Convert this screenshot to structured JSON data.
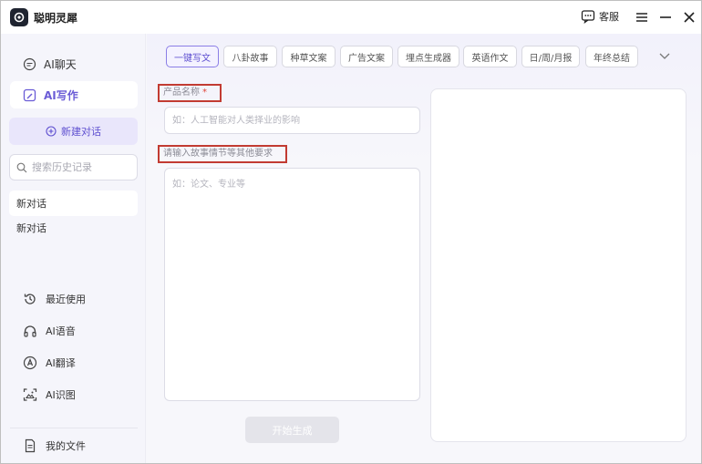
{
  "app": {
    "title": "聪明灵犀",
    "service_label": "客服"
  },
  "sidebar": {
    "nav": [
      {
        "label": "AI聊天",
        "icon": "chat-icon"
      },
      {
        "label": "AI写作",
        "icon": "write-icon",
        "active": true
      }
    ],
    "new_chat_label": "新建对话",
    "search_placeholder": "搜索历史记录",
    "history": [
      {
        "label": "新对话",
        "selected": true
      },
      {
        "label": "新对话",
        "selected": false
      }
    ],
    "tools": [
      {
        "label": "最近使用",
        "icon": "history-icon"
      },
      {
        "label": "AI语音",
        "icon": "headphone-icon"
      },
      {
        "label": "AI翻译",
        "icon": "translate-icon"
      },
      {
        "label": "AI识图",
        "icon": "scan-image-icon"
      }
    ],
    "files_label": "我的文件"
  },
  "main": {
    "tabs": [
      {
        "label": "一键写文",
        "active": true
      },
      {
        "label": "八卦故事"
      },
      {
        "label": "种草文案"
      },
      {
        "label": "广告文案"
      },
      {
        "label": "埋点生成器"
      },
      {
        "label": "英语作文"
      },
      {
        "label": "日/周/月报"
      },
      {
        "label": "年终总结"
      }
    ],
    "product_label": "产品名称",
    "required_mark": "*",
    "product_placeholder": "如：人工智能对人类择业的影响",
    "story_label": "请输入故事情节等其他要求",
    "story_placeholder": "如：论文、专业等",
    "generate_label": "开始生成"
  },
  "colors": {
    "accent": "#6a5bd6",
    "highlight_border": "#c23b32"
  }
}
